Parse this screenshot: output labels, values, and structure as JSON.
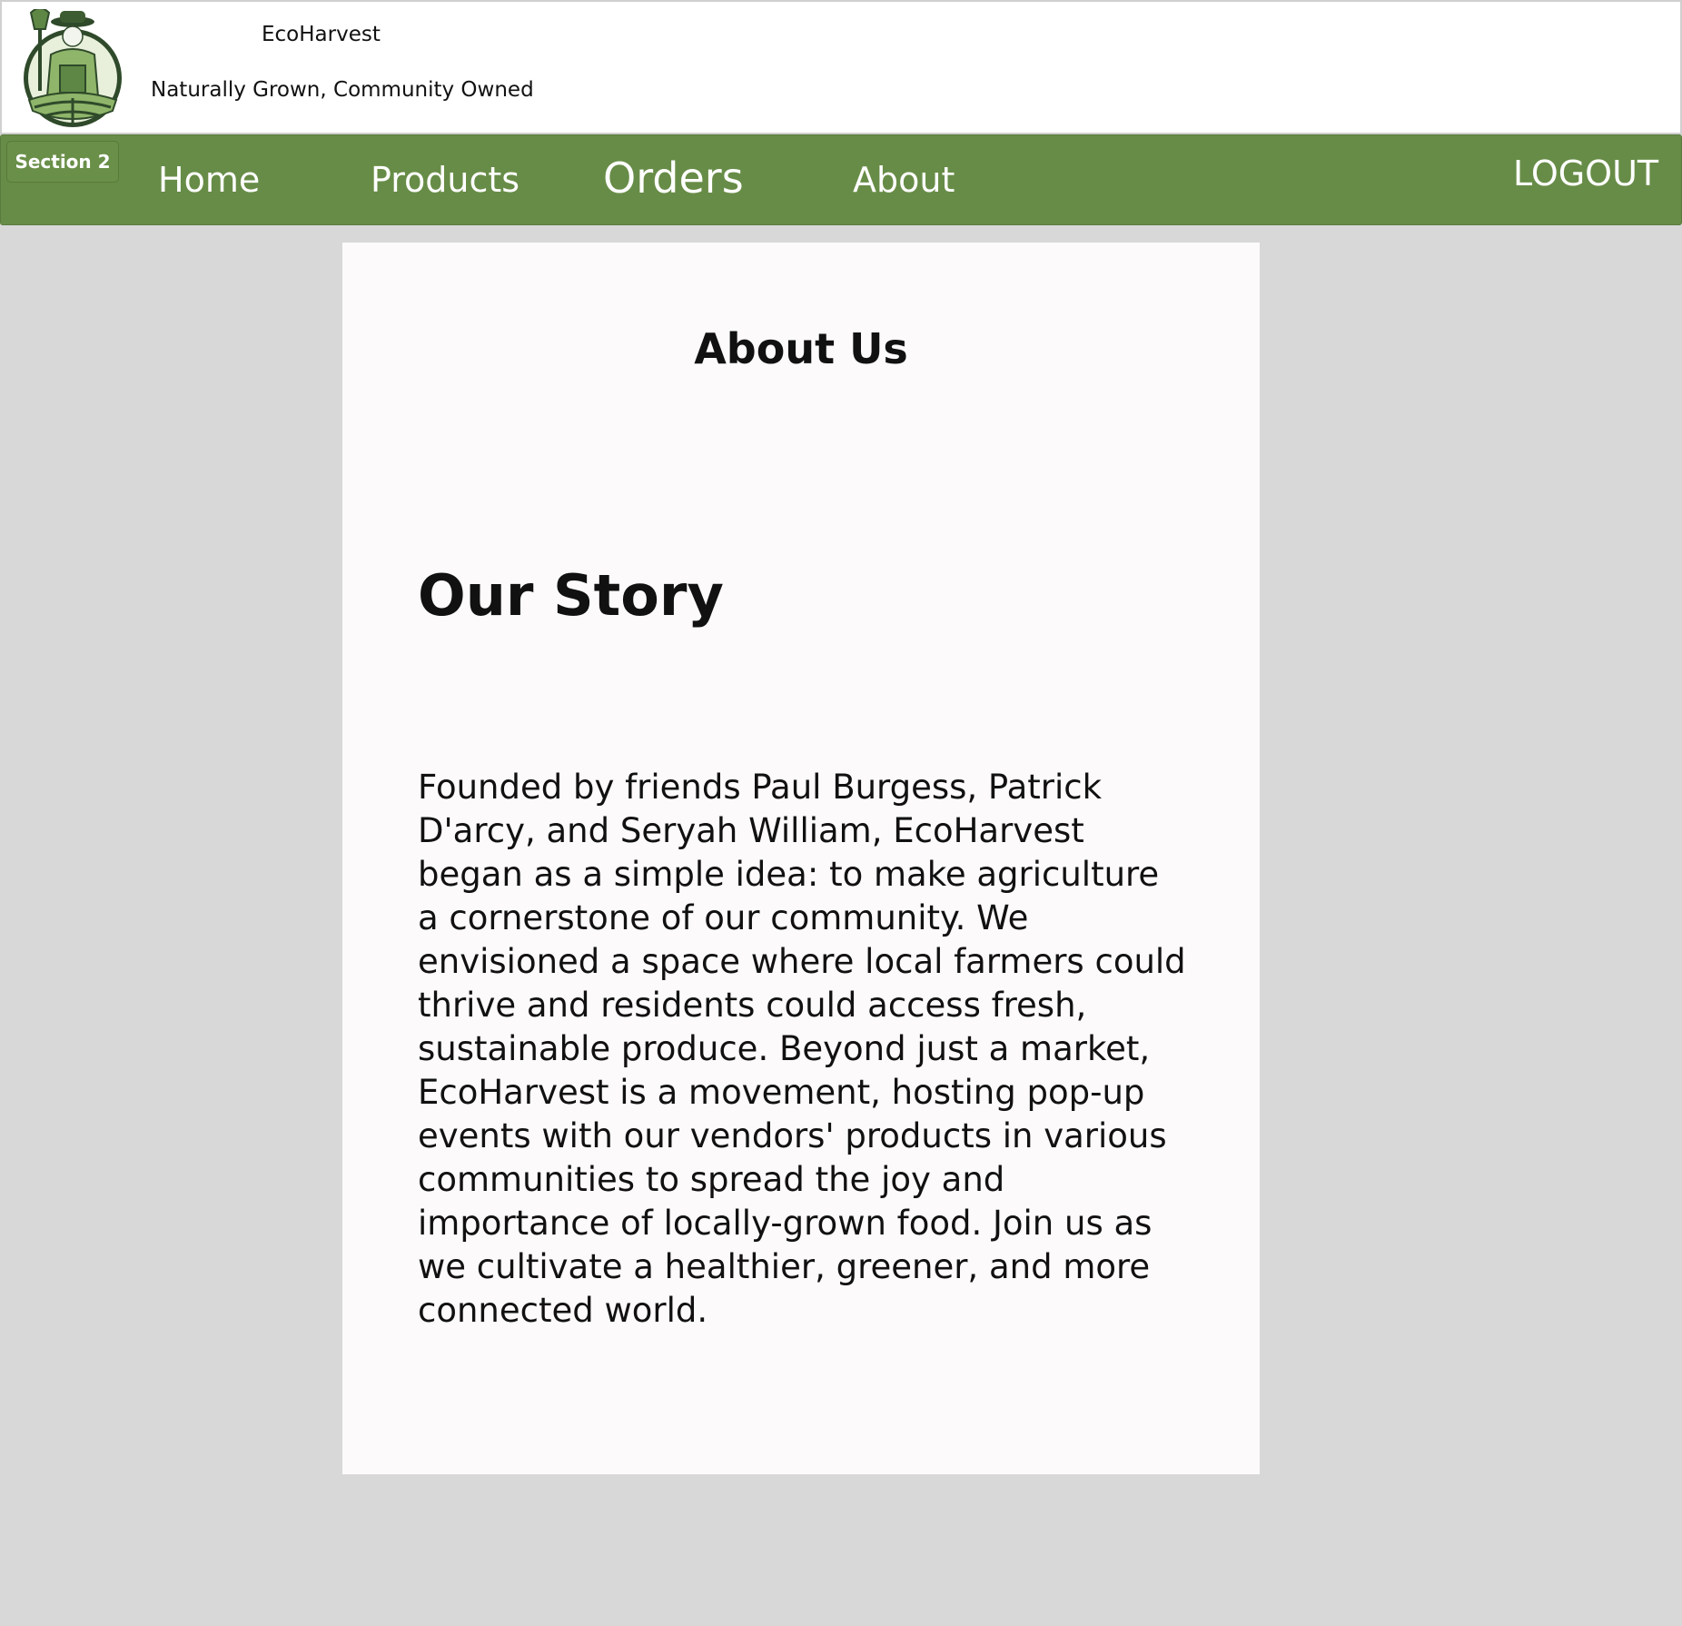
{
  "header": {
    "brand_name": "EcoHarvest",
    "tagline": "Naturally Grown, Community Owned",
    "logo_icon": "farmer-logo-icon"
  },
  "nav": {
    "section_badge": "Section 2",
    "home": "Home",
    "products": "Products",
    "orders": "Orders",
    "about": "About",
    "logout": "LOGOUT"
  },
  "main": {
    "page_title": "About Us",
    "story_heading": "Our Story",
    "story_text": "Founded by friends Paul Burgess, Patrick D'arcy, and Seryah William, EcoHarvest began as a simple idea: to make agriculture a cornerstone of our community. We envisioned a space where local farmers could thrive and residents could access fresh, sustainable produce. Beyond just a market, EcoHarvest is a movement, hosting pop-up events with our vendors' products in various communities to spread the joy and importance of locally-grown food. Join us as we cultivate a healthier, greener, and more connected world."
  },
  "colors": {
    "navbar": "#678c47",
    "page_background": "#d8d8d8",
    "card_background": "#fcfafa",
    "logo_dark_green": "#2f4a2a",
    "logo_light_green": "#8fb56a"
  }
}
